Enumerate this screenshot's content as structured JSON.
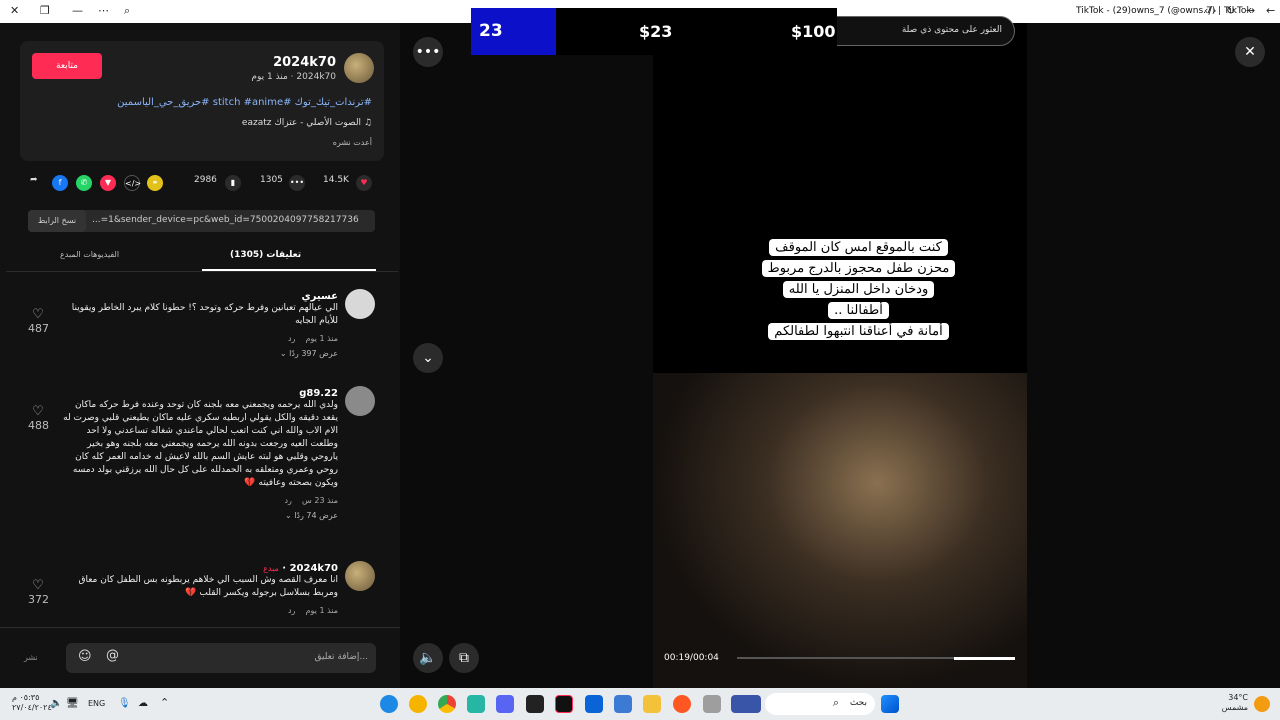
{
  "window": {
    "title": "TikTok - (29)owns_7 (@owns.7) | TikTok"
  },
  "post": {
    "follow_label": "متابعة",
    "author": "2024k70",
    "author_sub": "2024k70 · منذ 1 يوم",
    "hashtags": "#ترندات_تيك_توك #stitch #anime #حريق_حي_الياسمين",
    "sound": "♫ الصوت الأصلي - عتزاك eazatz",
    "repost": "أعدت نشره",
    "likes": "14.5K",
    "comments": "1305",
    "saves": "2986",
    "link": "...=1&sender_device=pc&web_id=7500204097758217736",
    "copy_label": "نسخ الرابط"
  },
  "tabs": {
    "comments": "(1305) تعليقات",
    "videos": "الفيديوهات المبدع"
  },
  "comments": [
    {
      "name": "عسيري",
      "text": [
        "الي عيالهم تعبانين وفرط حركه وتوحد ؟! حطونا كلام يبرد الخاطر ويقوينا",
        "للأيام الجايه"
      ],
      "time": "منذ 1 يوم",
      "reply": "رد",
      "replies": "عرض 397 ردًا",
      "likes": "487"
    },
    {
      "name": "g89.22",
      "text": [
        "ولدي الله يرحمه ويجمعني معه بلجنه كان توحد وعنده فرط حركه ماكان",
        "يقعد دقيقه والكل يقولي اربطيه سكري عليه ماكان يطيعني قلبي وصرت له",
        "الام الاب والله اني كنت اتعب لحالي ماعندي شغاله تساعدني ولا احد",
        "وطلعت العيه ورجعت بدونه الله يرحمه ويجمعني معه بلجنه وهو بخير",
        "ياروحي وقلبي هو لبته عايش السم بالله لاعيش له خدامه العمر كله كان",
        "روحي وعمري ومتعلقه به الحمدلله على كل حال الله يرزقني بولد دمسه",
        "ويكون بصحته وعافيته"
      ],
      "time": "منذ 23 س",
      "reply": "رد",
      "replies": "عرض 74 ردًا",
      "likes": "488"
    },
    {
      "name": "2024k70",
      "badge": "مبدع",
      "text": [
        "انا معرف القصه وش السبب الي خلاهم يربطونه بس الطفل كان معاق",
        "ومربط بسلاسل برجوله ويكسر القلب"
      ],
      "time": "منذ 1 يوم",
      "reply": "رد",
      "likes": "372"
    }
  ],
  "composer": {
    "placeholder": "إضافة تعليق...",
    "post_label": "نشر"
  },
  "video": {
    "search_placeholder": "العثور على محتوى ذي صلة",
    "caption_lines": [
      "كنت بالموقع امس كان الموقف",
      "محزن طفل محجوز بالدرج مربوط",
      "ودخان داخل المنزل يا الله",
      "أطفالنا ..",
      "أمانة في أعناقنا انتبهوا لطفالكم"
    ],
    "time": "00:19/00:04",
    "progress": 0.22
  },
  "ad": {
    "left": "23",
    "mid": "$23",
    "right": "$100"
  },
  "taskbar": {
    "search": "بحث",
    "lang": "ENG",
    "time": "٠٥:٣٥ م",
    "date": "٢٧/٠٤/٢٠٢٤",
    "weather_temp": "34°C",
    "weather_desc": "مشمس"
  },
  "colors": {
    "accent": "#fe2c55",
    "link": "#8ab4f8",
    "ad_blue": "#0c11c9"
  }
}
